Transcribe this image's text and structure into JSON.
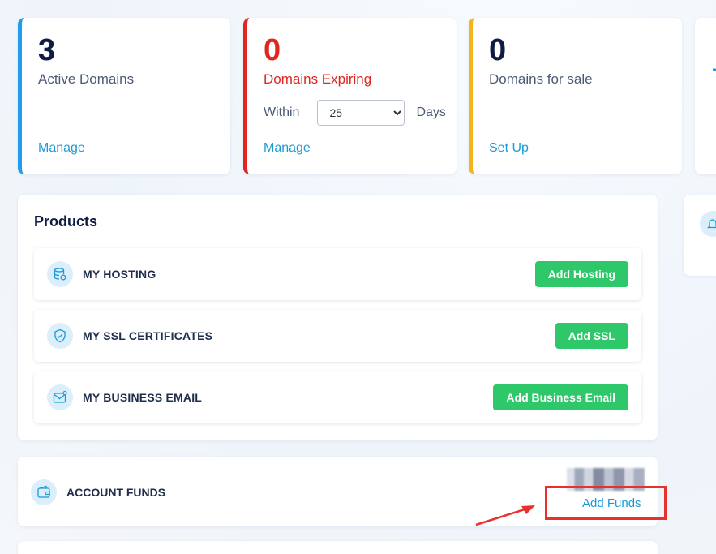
{
  "stats": [
    {
      "number": "3",
      "label": "Active Domains",
      "link": "Manage"
    },
    {
      "number": "0",
      "label": "Domains Expiring",
      "within_label": "Within",
      "within_value": "25",
      "days_label": "Days",
      "link": "Manage"
    },
    {
      "number": "0",
      "label": "Domains for sale",
      "link": "Set Up"
    }
  ],
  "products": {
    "title": "Products",
    "items": [
      {
        "name": "MY HOSTING",
        "button": "Add Hosting",
        "icon": "database-icon"
      },
      {
        "name": "MY SSL CERTIFICATES",
        "button": "Add SSL",
        "icon": "shield-check-icon"
      },
      {
        "name": "MY BUSINESS EMAIL",
        "button": "Add Business Email",
        "icon": "mail-icon"
      }
    ]
  },
  "funds": {
    "name": "ACCOUNT FUNDS",
    "link": "Add Funds",
    "icon": "wallet-icon"
  },
  "colors": {
    "accent": "#1a9bd7",
    "green": "#2ec86a",
    "red": "#e0261f",
    "blue": "#1e9cf0",
    "orange": "#f5b31c"
  }
}
